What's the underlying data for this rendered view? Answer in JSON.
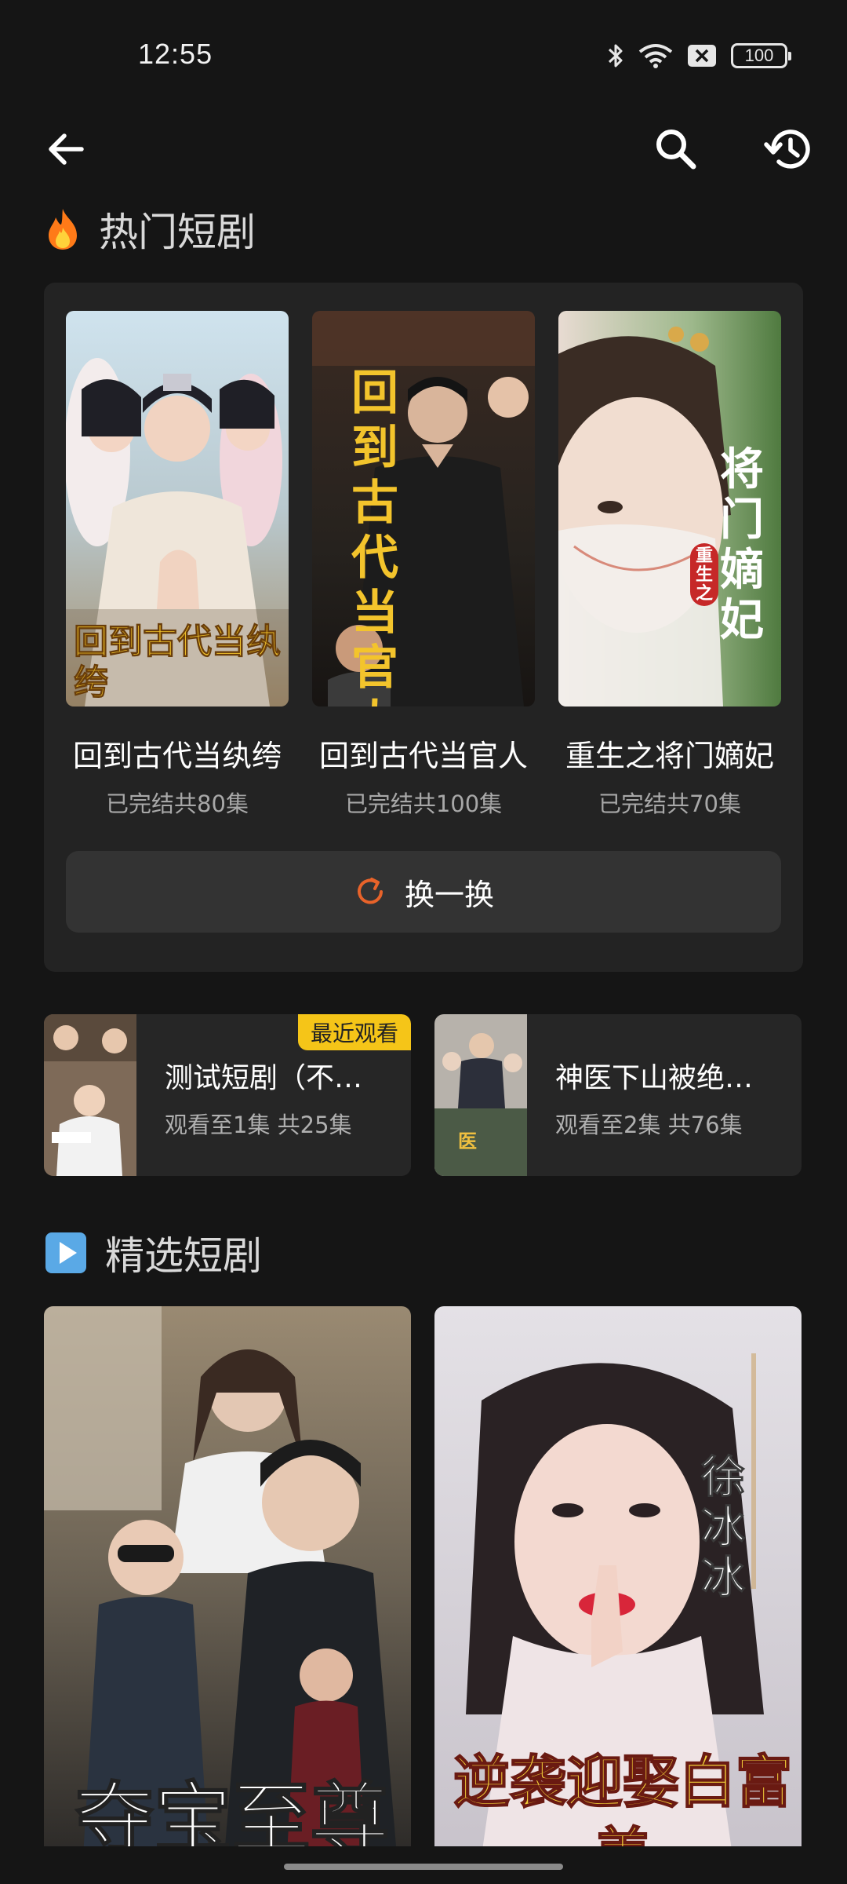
{
  "status_bar": {
    "time": "12:55",
    "battery": "100",
    "icons": [
      "bluetooth-icon",
      "wifi-icon",
      "sim-off-icon",
      "battery-icon"
    ]
  },
  "top_bar": {
    "icons": [
      "back-arrow-icon",
      "search-icon",
      "history-icon"
    ]
  },
  "hot_section": {
    "emoji": "🔥",
    "title": "热门短剧",
    "items": [
      {
        "name": "回到古代当纨绔",
        "meta": "已完结共80集",
        "poster_text": "回到古代当纨绔"
      },
      {
        "name": "回到古代当官人",
        "meta": "已完结共100集",
        "poster_text": "回到古代当官人"
      },
      {
        "name": "重生之将门嫡妃",
        "meta": "已完结共70集",
        "poster_text": "将门嫡妃",
        "poster_sub": "重生之"
      }
    ],
    "refresh_label": "换一换"
  },
  "recent_watch": [
    {
      "title": "测试短剧（不…",
      "meta": "观看至1集 共25集",
      "badge": "最近观看"
    },
    {
      "title": "神医下山被绝…",
      "meta": "观看至2集 共76集"
    }
  ],
  "selected_section": {
    "emoji": "▶️",
    "title": "精选短剧",
    "posters": [
      {
        "poster_text": "夺宝至尊"
      },
      {
        "poster_text": "逆袭迎娶白富美",
        "poster_sub": "徐冰冰"
      }
    ]
  },
  "colors": {
    "background": "#151515",
    "card": "#232323",
    "button": "#333333",
    "accent_orange": "#e8632a",
    "badge_yellow": "#f5c518"
  }
}
